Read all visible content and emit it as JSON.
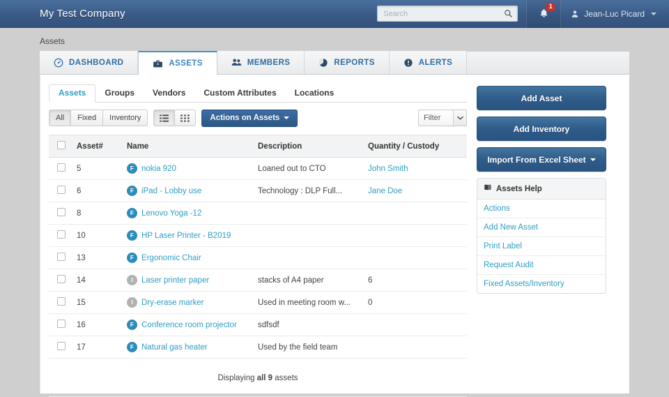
{
  "topbar": {
    "brand": "My Test Company",
    "search": {
      "placeholder": "Search",
      "value": "",
      "icon": "search-icon"
    },
    "notifications": {
      "icon": "bell-icon",
      "count": "1"
    },
    "user": {
      "icon": "user-icon",
      "name": "Jean-Luc Picard",
      "caret": "chevron-down-icon"
    }
  },
  "breadcrumb": "Assets",
  "nav_tabs": [
    {
      "label": "DASHBOARD",
      "icon": "gauge-icon",
      "active": false
    },
    {
      "label": "ASSETS",
      "icon": "briefcase-icon",
      "active": true
    },
    {
      "label": "MEMBERS",
      "icon": "people-icon",
      "active": false
    },
    {
      "label": "REPORTS",
      "icon": "pie-chart-icon",
      "active": false
    },
    {
      "label": "ALERTS",
      "icon": "exclamation-circle-icon",
      "active": false
    }
  ],
  "sub_tabs": [
    {
      "label": "Assets",
      "active": true
    },
    {
      "label": "Groups",
      "active": false
    },
    {
      "label": "Vendors",
      "active": false
    },
    {
      "label": "Custom Attributes",
      "active": false
    },
    {
      "label": "Locations",
      "active": false
    }
  ],
  "toolbar": {
    "scope_filters": [
      {
        "label": "All",
        "active": true
      },
      {
        "label": "Fixed",
        "active": false
      },
      {
        "label": "Inventory",
        "active": false
      }
    ],
    "view_list_icon": "list-view-icon",
    "view_grid_icon": "grid-view-icon",
    "actions_label": "Actions on Assets",
    "filter_label": "Filter",
    "filter_options": [
      "Filter"
    ]
  },
  "table": {
    "columns": [
      "",
      "Asset#",
      "Name",
      "Description",
      "Quantity / Custody"
    ],
    "rows": [
      {
        "num": "5",
        "badge": "F",
        "name": "nokia 920",
        "desc": "Loaned out to CTO",
        "qty": "John Smith",
        "qty_is_link": true
      },
      {
        "num": "6",
        "badge": "F",
        "name": "iPad - Lobby use",
        "desc": "Technology : DLP Full...",
        "qty": "Jane Doe",
        "qty_is_link": true
      },
      {
        "num": "8",
        "badge": "F",
        "name": "Lenovo Yoga -12",
        "desc": "",
        "qty": "",
        "qty_is_link": false
      },
      {
        "num": "10",
        "badge": "F",
        "name": "HP Laser Printer - B2019",
        "desc": "",
        "qty": "",
        "qty_is_link": false
      },
      {
        "num": "13",
        "badge": "F",
        "name": "Ergonomic Chair",
        "desc": "",
        "qty": "",
        "qty_is_link": false
      },
      {
        "num": "14",
        "badge": "I",
        "name": "Laser printer paper",
        "desc": "stacks of A4 paper",
        "qty": "6",
        "qty_is_link": false
      },
      {
        "num": "15",
        "badge": "I",
        "name": "Dry-erase marker",
        "desc": "Used in meeting room w...",
        "qty": "0",
        "qty_is_link": false
      },
      {
        "num": "16",
        "badge": "F",
        "name": "Conference room projector",
        "desc": "sdfsdf",
        "qty": "",
        "qty_is_link": false
      },
      {
        "num": "17",
        "badge": "F",
        "name": "Natural gas heater",
        "desc": "Used by the field team",
        "qty": "",
        "qty_is_link": false
      }
    ],
    "footer_prefix": "Displaying ",
    "footer_strong": "all 9",
    "footer_suffix": " assets"
  },
  "sidebar": {
    "buttons": [
      {
        "label": "Add Asset",
        "caret": false
      },
      {
        "label": "Add Inventory",
        "caret": false
      },
      {
        "label": "Import From Excel Sheet",
        "caret": true
      }
    ],
    "help_panel": {
      "icon": "book-icon",
      "title": "Assets Help",
      "links": [
        "Actions",
        "Add New Asset",
        "Print Label",
        "Request Audit",
        "Fixed Assets/Inventory"
      ]
    }
  },
  "colors": {
    "header_blue": "#3a5a86",
    "accent_link": "#2f9ec4",
    "badge_fixed": "#2e8bba",
    "badge_inventory": "#b2b2b2",
    "button_blue": "#2f5c8a",
    "badge_red": "#c9302c"
  }
}
